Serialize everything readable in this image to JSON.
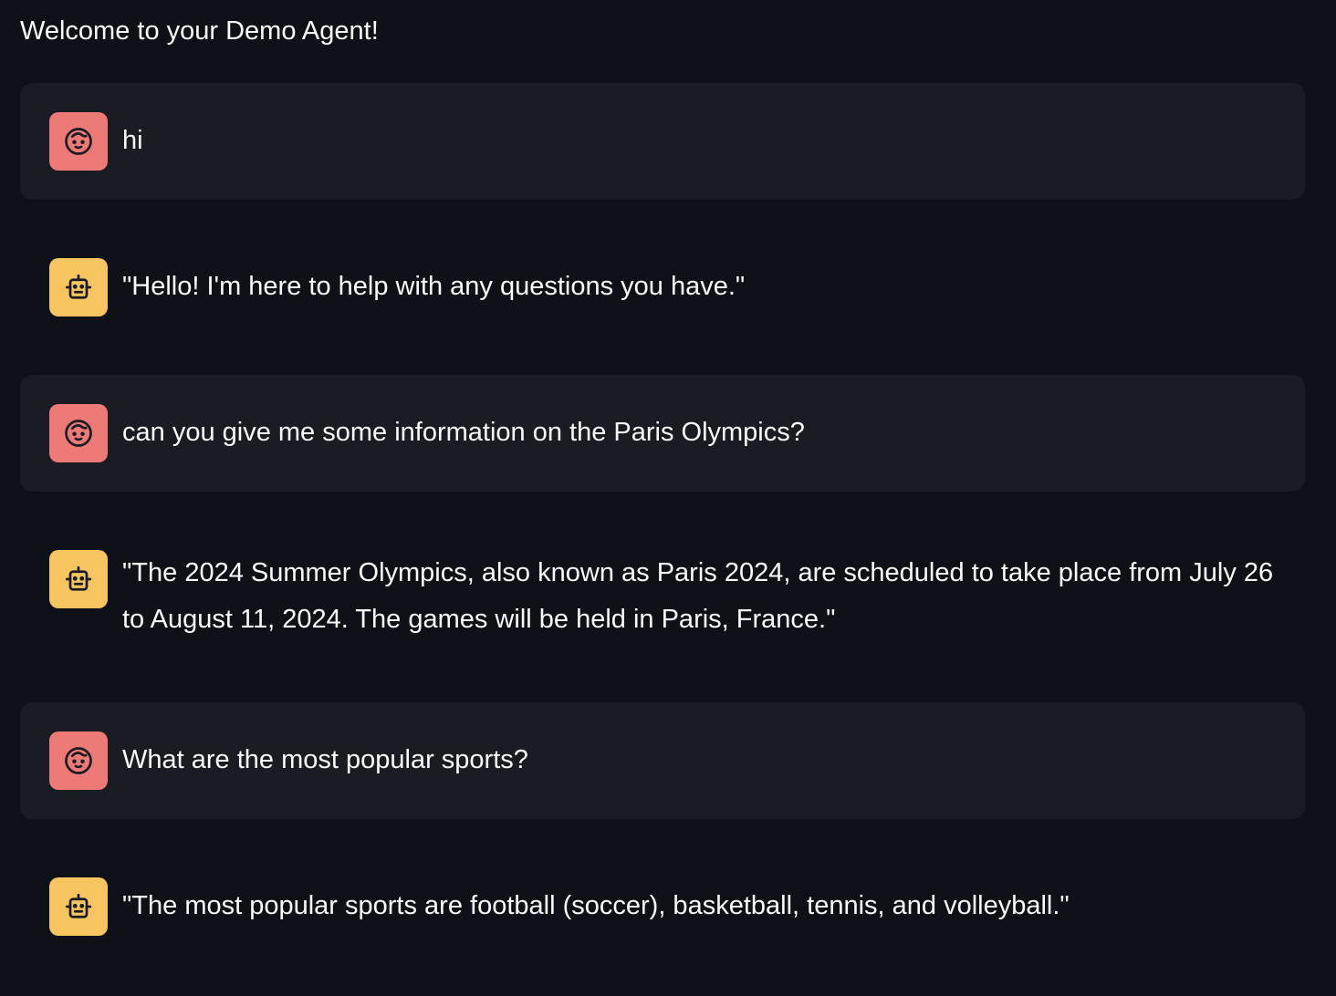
{
  "header": {
    "welcome": "Welcome to your Demo Agent!"
  },
  "colors": {
    "background": "#0e1117",
    "user_message_bg": "#1a1c24",
    "user_avatar": "#ee7a78",
    "assistant_avatar": "#f7c55f",
    "text": "#fafafa"
  },
  "messages": [
    {
      "role": "user",
      "icon": "user-face-icon",
      "text": "hi"
    },
    {
      "role": "assistant",
      "icon": "robot-icon",
      "text": "\"Hello! I'm here to help with any questions you have.\""
    },
    {
      "role": "user",
      "icon": "user-face-icon",
      "text": "can you give me some information on the Paris Olympics?"
    },
    {
      "role": "assistant",
      "icon": "robot-icon",
      "text": "\"The 2024 Summer Olympics, also known as Paris 2024, are scheduled to take place from July 26 to August 11, 2024. The games will be held in Paris, France.\""
    },
    {
      "role": "user",
      "icon": "user-face-icon",
      "text": "What are the most popular sports?"
    },
    {
      "role": "assistant",
      "icon": "robot-icon",
      "text": "\"The most popular sports are football (soccer), basketball, tennis, and volleyball.\""
    }
  ]
}
